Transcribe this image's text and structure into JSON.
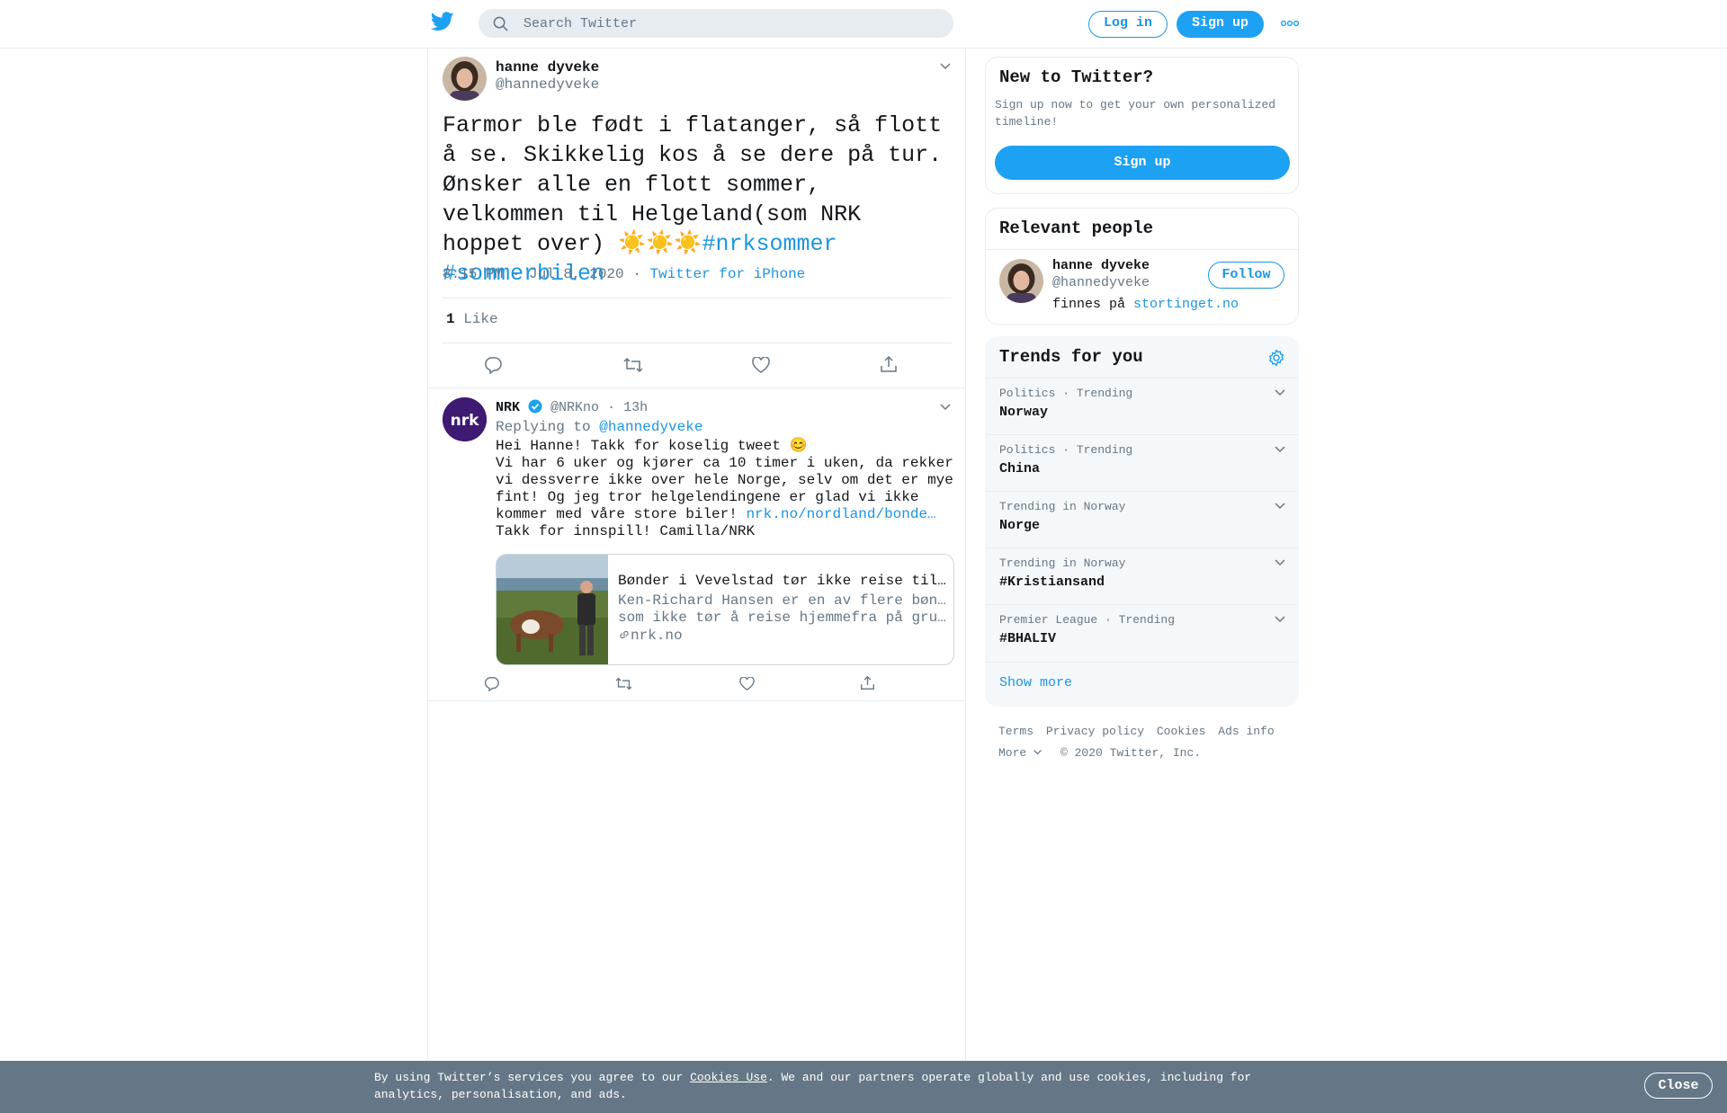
{
  "nav": {
    "search_placeholder": "Search Twitter",
    "login": "Log in",
    "signup": "Sign up"
  },
  "tweet": {
    "name": "hanne dyveke",
    "handle": "@hannedyveke",
    "text": "Farmor ble født i flatanger, så flott å se. Skikkelig kos å se dere på tur. Ønsker alle en flott sommer, velkommen til Helgeland(som NRK hoppet over) ☀️☀️",
    "emoji_tail": "☀️",
    "hashtags": [
      "#nrksommer",
      "#sommerbilen"
    ],
    "time": "8:15 PM · Jul 8, 2020",
    "source": "Twitter for iPhone",
    "like_count": "1",
    "like_label": "Like"
  },
  "reply": {
    "name": "NRK",
    "handle": "@NRKno",
    "age": "13h",
    "replying_prefix": "Replying to",
    "replying_to": "@hannedyveke",
    "line1": "Hei Hanne! Takk for koselig tweet 😊",
    "line2": "Vi har 6 uker og kjører ca 10 timer i uken, da rekker vi dessverre ikke over hele Norge, selv om det er mye fint! Og jeg tror helgelendingene er glad vi ikke kommer med våre store biler!",
    "link": "nrk.no/nordland/bonde…",
    "line3": "Takk for innspill! Camilla/NRK",
    "card": {
      "title": "Bønder i Vevelstad tør ikke reise til b…",
      "desc1": "Ken-Richard Hansen er en av flere bønder",
      "desc2": "som ikke tør å reise hjemmefra på grunn…",
      "domain": "nrk.no"
    }
  },
  "sidebar": {
    "new": {
      "title": "New to Twitter?",
      "subtitle": "Sign up now to get your own personalized timeline!",
      "button": "Sign up"
    },
    "relevant": {
      "title": "Relevant people",
      "name": "hanne dyveke",
      "handle": "@hannedyveke",
      "bio_prefix": "finnes på",
      "bio_link": "stortinget.no",
      "follow": "Follow"
    },
    "trends": {
      "title": "Trends for you",
      "items": [
        {
          "context": "Politics · Trending",
          "name": "Norway"
        },
        {
          "context": "Politics · Trending",
          "name": "China"
        },
        {
          "context": "Trending in Norway",
          "name": "Norge"
        },
        {
          "context": "Trending in Norway",
          "name": "#Kristiansand"
        },
        {
          "context": "Premier League · Trending",
          "name": "#BHALIV"
        }
      ],
      "show_more": "Show more"
    },
    "footer": {
      "terms": "Terms",
      "privacy": "Privacy policy",
      "cookies": "Cookies",
      "ads": "Ads info",
      "more": "More",
      "copyright": "© 2020 Twitter, Inc."
    }
  },
  "cookie": {
    "prefix": "By using Twitter’s services you agree to our",
    "link": "Cookies Use",
    "suffix": ". We and our partners operate globally and use cookies, including for analytics, personalisation, and ads.",
    "close": "Close"
  },
  "colors": {
    "brand": "#1da1f2",
    "link": "#1b95e0",
    "muted": "#657786",
    "border": "#e6ecf0",
    "cookie_bg": "#657786"
  },
  "icons": [
    "twitter-logo-icon",
    "search-icon",
    "more-dots-icon",
    "chevron-down-icon",
    "reply-icon",
    "retweet-icon",
    "like-icon",
    "share-icon",
    "verified-icon",
    "link-icon",
    "gear-icon"
  ]
}
